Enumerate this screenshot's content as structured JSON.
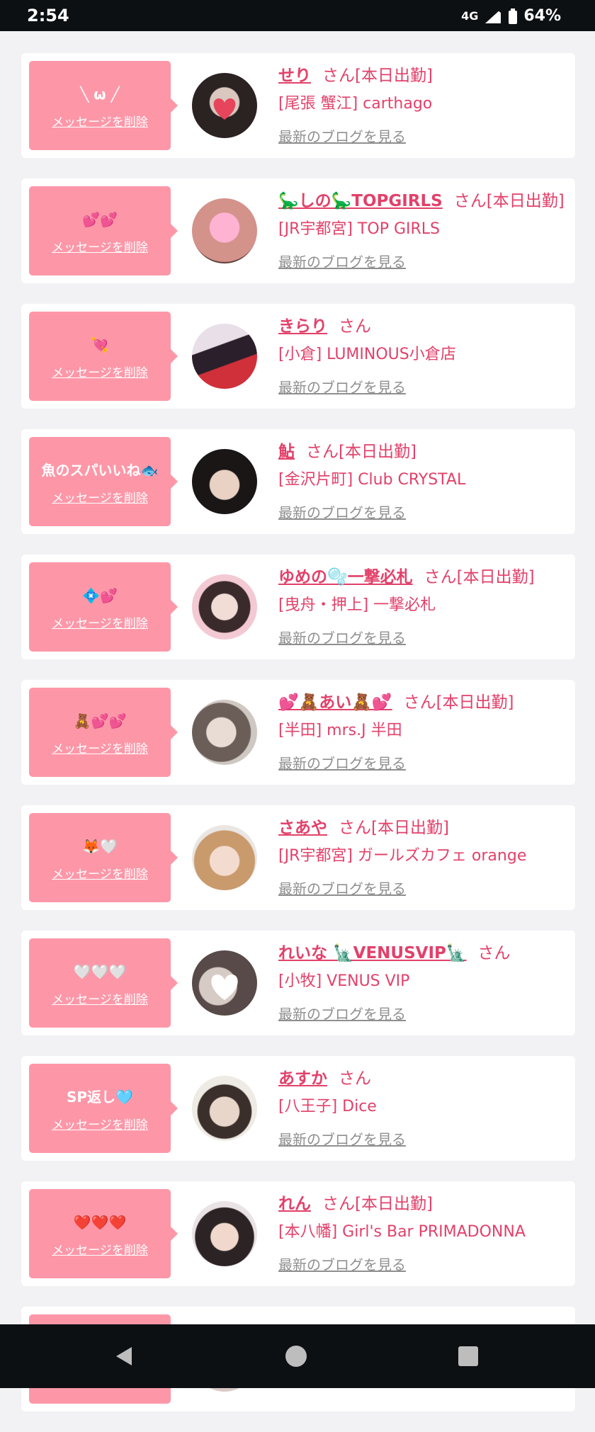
{
  "status_bar": {
    "time": "2:54",
    "network": "4G",
    "battery": "64%",
    "icons": [
      "signal-icon",
      "battery-icon"
    ]
  },
  "colors": {
    "accent": "#e2416a",
    "bubble": "#fd97a8",
    "muted": "#8f8f8f",
    "background": "#f2f2f4"
  },
  "labels": {
    "delete": "メッセージを削除",
    "blog": "最新のブログを見る"
  },
  "cards": [
    {
      "message": "╲ ω ╱",
      "name": "せり",
      "suffix": "さん[本日出勤]",
      "shop": "[尾張 蟹江] carthago"
    },
    {
      "message": "💕💕",
      "name": "🦕しの🦕TOPGIRLS",
      "suffix": "さん[本日出勤]",
      "shop": "[JR宇都宮] TOP GIRLS"
    },
    {
      "message": "💘",
      "name": "きらり",
      "suffix": "さん",
      "shop": "[小倉] LUMINOUS小倉店"
    },
    {
      "message": "魚のスパいいね🐟",
      "name": "鮎",
      "suffix": "さん[本日出勤]",
      "shop": "[金沢片町] Club CRYSTAL"
    },
    {
      "message": "💠💕",
      "name": "ゆめの🫧一撃必札",
      "suffix": "さん[本日出勤]",
      "shop": "[曳舟・押上] 一撃必札"
    },
    {
      "message": "🧸💕💕",
      "name": "💕🧸あい🧸💕",
      "suffix": "さん[本日出勤]",
      "shop": "[半田] mrs.J 半田"
    },
    {
      "message": "🦊🤍",
      "name": "さあや",
      "suffix": "さん[本日出勤]",
      "shop": "[JR宇都宮] ガールズカフェ orange"
    },
    {
      "message": "🤍🤍🤍",
      "name": "れいな 🗽VENUSVIP🗽",
      "suffix": "さん",
      "shop": "[小牧] VENUS VIP"
    },
    {
      "message": "SP返し🩵",
      "name": "あすか",
      "suffix": "さん",
      "shop": "[八王子] Dice"
    },
    {
      "message": "❤️❤️❤️",
      "name": "れん",
      "suffix": "さん[本日出勤]",
      "shop": "[本八幡] Girl's Bar PRIMADONNA"
    },
    {
      "message": "",
      "name": "",
      "suffix": "",
      "shop": ""
    }
  ],
  "nav": {
    "buttons": [
      "back-icon",
      "home-icon",
      "recents-icon"
    ]
  }
}
